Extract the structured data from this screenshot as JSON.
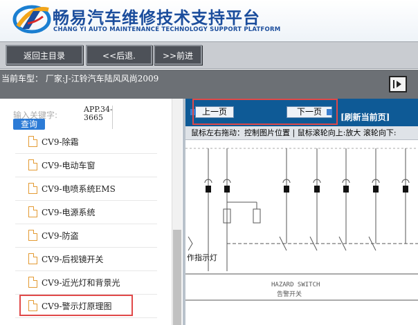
{
  "header": {
    "title_cn": "畅易汽车维修技术支持平台",
    "title_en": "CHANG YI AUTO MAINTENANCE TECHNOLOGY SUPPORT PLATFORM",
    "brand_color": "#1b4d9c"
  },
  "nav": {
    "home": "返回主目录",
    "back": "<<后退.",
    "forward": ">>前进"
  },
  "vehicle": {
    "label": "当前车型： 厂家:J-江铃汽车陆风风尚2009"
  },
  "left": {
    "search_placeholder": "输入关键字:",
    "search_button": "查询",
    "app_code": "APP.34-3665",
    "tree_items": [
      "CV9-除霜",
      "CV9-电动车窗",
      "CV9-电喷系统EMS",
      "CV9-电源系统",
      "CV9-防盗",
      "CV9-后视镜开关",
      "CV9-近光灯和背景光",
      "CV9-警示灯原理图"
    ],
    "icon": "document-icon"
  },
  "viewer": {
    "prev_page": "上一页",
    "next_page": "下一页",
    "refresh": "[刷新当前页]",
    "hint": "鼠标左右拖动：控制图片位置 | 鼠标滚轮向上:放大  滚轮向下:",
    "diagram": {
      "lamp_label": "作指示灯",
      "switch_en": "HAZARD  SWITCH",
      "switch_cn": "告警开关"
    }
  },
  "colors": {
    "toolbar": "#0e5a96",
    "highlight": "#e04848",
    "navbar": "#c9ccd1",
    "vehicle_bar": "#6c7075"
  }
}
